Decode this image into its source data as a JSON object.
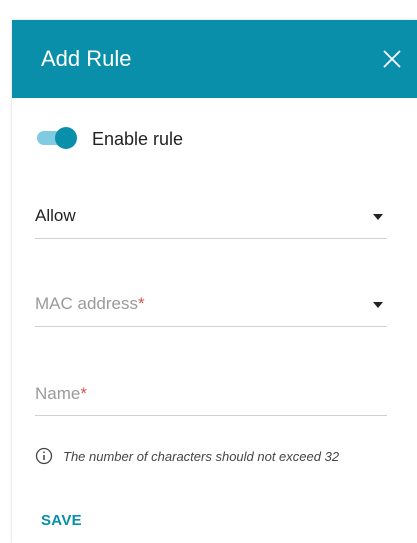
{
  "dialog": {
    "title": "Add Rule",
    "close_icon": "close-icon"
  },
  "enable_rule": {
    "label": "Enable rule",
    "checked": true
  },
  "action_select": {
    "value": "Allow",
    "icon": "chevron-down-icon"
  },
  "mac_address": {
    "placeholder": "MAC address",
    "required_mark": "*",
    "icon": "chevron-down-icon"
  },
  "name_field": {
    "placeholder": "Name",
    "required_mark": "*",
    "value": ""
  },
  "hint": {
    "icon": "info-icon",
    "text": "The number of characters should not exceed 32"
  },
  "actions": {
    "save_label": "SAVE"
  },
  "colors": {
    "accent": "#0a8fab",
    "toggle_track": "#7fcbe1",
    "required": "#d9534f",
    "placeholder": "#9a9a9a"
  }
}
